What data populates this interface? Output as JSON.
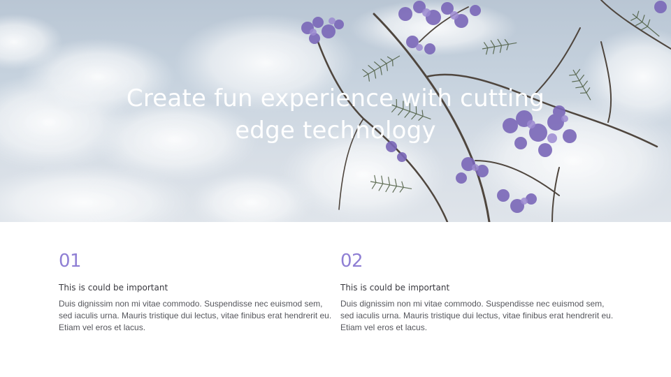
{
  "hero": {
    "title_line_1": "Create fun experience with cutting",
    "title_line_2": "edge technology"
  },
  "columns": [
    {
      "number": "01",
      "subtitle": "This is could be important",
      "body": "Duis dignissim non mi vitae commodo. Suspendisse nec euismod sem, sed iaculis urna. Mauris tristique dui lectus, vitae finibus erat hendrerit eu. Etiam vel eros et lacus."
    },
    {
      "number": "02",
      "subtitle": "This is could be important",
      "body": "Duis dignissim non mi vitae commodo. Suspendisse nec euismod sem, sed iaculis urna. Mauris tristique dui lectus, vitae finibus erat hendrerit eu. Etiam vel eros et lacus."
    }
  ],
  "colors": {
    "accent": "#8f7fd4",
    "sky": "#c6d2de",
    "blossom": "#7a67b8",
    "foliage": "#4a5a3e"
  }
}
